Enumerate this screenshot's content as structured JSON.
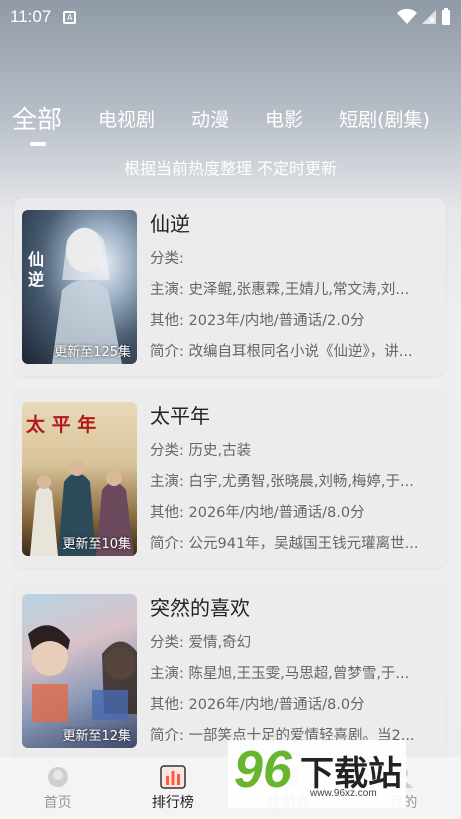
{
  "status": {
    "time": "11:07"
  },
  "tabs": [
    {
      "label": "全部"
    },
    {
      "label": "电视剧"
    },
    {
      "label": "动漫"
    },
    {
      "label": "电影"
    },
    {
      "label": "短剧(剧集)"
    }
  ],
  "subtitle": "根据当前热度整理 不定时更新",
  "items": [
    {
      "title": "仙逆",
      "badge": "更新至125集",
      "poster_text": "仙逆",
      "genre": "分类: ",
      "cast": "主演: 史泽鲲,张惠霖,王婧儿,常文涛,刘...",
      "other": "其他: 2023年/内地/普通话/2.0分",
      "intro": "简介: 改编自耳根同名小说《仙逆》，讲..."
    },
    {
      "title": "太平年",
      "badge": "更新至10集",
      "poster_text": "太 平 年",
      "genre": "分类: 历史,古装",
      "cast": "主演: 白宇,尤勇智,张晓晨,刘畅,梅婷,于...",
      "other": "其他: 2026年/内地/普通话/8.0分",
      "intro": "简介: 公元941年，吴越国王钱元瓘离世..."
    },
    {
      "title": "突然的喜欢",
      "badge": "更新至12集",
      "poster_text": "",
      "genre": "分类: 爱情,奇幻",
      "cast": "主演: 陈星旭,王玉雯,马思超,曾梦雪,于...",
      "other": "其他: 2026年/内地/普通话/8.0分",
      "intro": "简介: 一部笑点十足的爱情轻喜剧。当2..."
    }
  ],
  "nav": [
    {
      "label": "首页",
      "icon": "home-icon"
    },
    {
      "label": "排行榜",
      "icon": "ranking-icon"
    },
    {
      "label": "排期表",
      "icon": "schedule-icon"
    },
    {
      "label": "我的",
      "icon": "profile-icon"
    }
  ],
  "watermark": {
    "num": "96",
    "text": "下载站",
    "url": "www.96xz.com"
  }
}
